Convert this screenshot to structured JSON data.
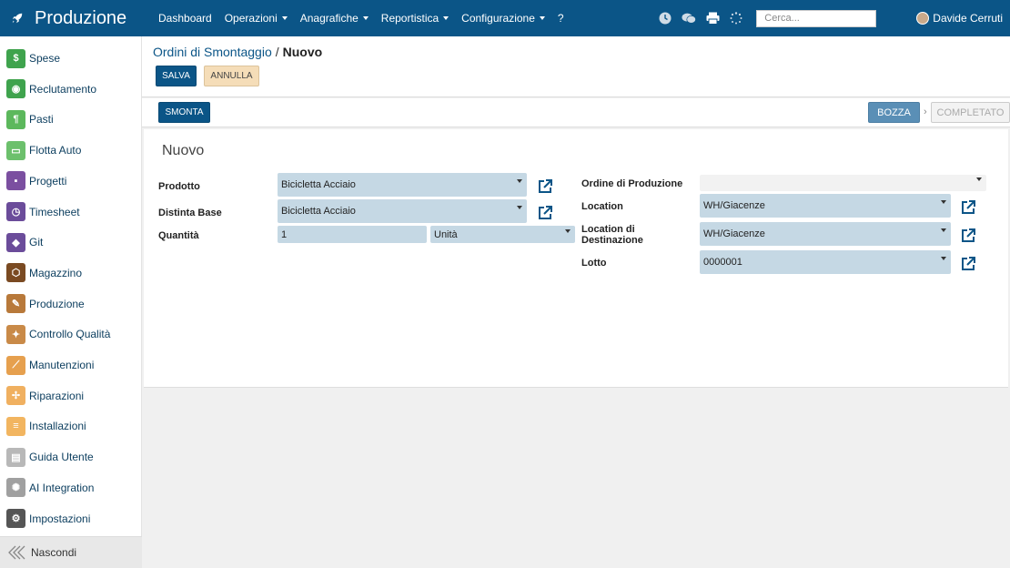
{
  "app": {
    "title": "Produzione",
    "brand_icon": "rocket-icon"
  },
  "topnav": {
    "items": [
      {
        "label": "Dashboard",
        "dropdown": false
      },
      {
        "label": "Operazioni",
        "dropdown": true
      },
      {
        "label": "Anagrafiche",
        "dropdown": true
      },
      {
        "label": "Reportistica",
        "dropdown": true
      },
      {
        "label": "Configurazione",
        "dropdown": true
      },
      {
        "label": "?",
        "dropdown": false
      }
    ],
    "search_placeholder": "Cerca...",
    "user_name": "Davide Cerruti"
  },
  "sidebar": {
    "items": [
      {
        "label": "Spese",
        "icon": "dollar-icon",
        "color": "#3fa34d"
      },
      {
        "label": "Reclutamento",
        "icon": "recruit-icon",
        "color": "#3fa34d"
      },
      {
        "label": "Pasti",
        "icon": "cutlery-icon",
        "color": "#5cb85c"
      },
      {
        "label": "Flotta Auto",
        "icon": "car-icon",
        "color": "#6cc06c"
      },
      {
        "label": "Progetti",
        "icon": "project-icon",
        "color": "#7b4fa0"
      },
      {
        "label": "Timesheet",
        "icon": "clock-icon",
        "color": "#6b4c9a"
      },
      {
        "label": "Git",
        "icon": "git-icon",
        "color": "#6b4c9a"
      },
      {
        "label": "Magazzino",
        "icon": "warehouse-icon",
        "color": "#7a4a22"
      },
      {
        "label": "Produzione",
        "icon": "wrench-icon",
        "color": "#b8793a"
      },
      {
        "label": "Controllo Qualità",
        "icon": "quality-icon",
        "color": "#c98a48"
      },
      {
        "label": "Manutenzioni",
        "icon": "hammer-icon",
        "color": "#e6a04e"
      },
      {
        "label": "Riparazioni",
        "icon": "repair-icon",
        "color": "#f0b060"
      },
      {
        "label": "Installazioni",
        "icon": "install-icon",
        "color": "#f2b560"
      },
      {
        "label": "Guida Utente",
        "icon": "guide-icon",
        "color": "#b8b8b8"
      },
      {
        "label": "AI Integration",
        "icon": "ai-icon",
        "color": "#a0a0a0"
      },
      {
        "label": "Impostazioni",
        "icon": "gear-icon",
        "color": "#555555"
      }
    ],
    "hide_label": "Nascondi"
  },
  "breadcrumb": {
    "parent": "Ordini di Smontaggio",
    "separator": "/",
    "current": "Nuovo"
  },
  "buttons": {
    "save": "SALVA",
    "cancel": "ANNULLA",
    "disassemble": "SMONTA"
  },
  "status": {
    "draft": "BOZZA",
    "done": "COMPLETATO",
    "active": "BOZZA"
  },
  "form": {
    "title": "Nuovo",
    "product_label": "Prodotto",
    "product_value": "Bicicletta Acciaio",
    "bom_label": "Distinta Base",
    "bom_value": "Bicicletta Acciaio",
    "qty_label": "Quantità",
    "qty_value": "1",
    "uom_value": "Unità",
    "mo_label": "Ordine di Produzione",
    "mo_value": "",
    "location_label": "Location",
    "location_value": "WH/Giacenze",
    "dest_label_1": "Location di",
    "dest_label_2": "Destinazione",
    "dest_value": "WH/Giacenze",
    "lot_label": "Lotto",
    "lot_value": "0000001"
  },
  "colors": {
    "brand": "#0b5587",
    "field_bg": "#c5d8e4",
    "status_active": "#5a8fb6"
  }
}
